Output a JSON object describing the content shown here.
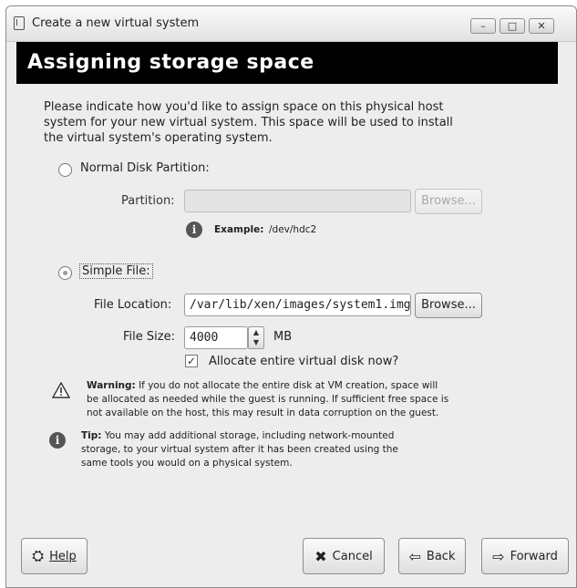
{
  "window": {
    "title": "Create a new virtual system",
    "controls": {
      "minimize": "–",
      "maximize": "□",
      "close": "✕"
    }
  },
  "banner": {
    "title": "Assigning storage space"
  },
  "intro": "Please indicate how you'd like to assign space on this physical host system for your new virtual system. This space will be used to install the virtual system's operating system.",
  "partition_option": {
    "label": "Normal Disk Partition:",
    "selected": false,
    "partition_label": "Partition:",
    "partition_value": "",
    "browse_label": "Browse...",
    "example_bold": "Example:",
    "example_value": "/dev/hdc2"
  },
  "file_option": {
    "label": "Simple File:",
    "selected": true,
    "location_label": "File Location:",
    "location_value": "/var/lib/xen/images/system1.img",
    "browse_label": "Browse...",
    "size_label": "File Size:",
    "size_value": "4000",
    "size_unit": "MB",
    "allocate_label": "Allocate entire virtual disk now?",
    "allocate_checked": true
  },
  "warning": {
    "bold": "Warning:",
    "line1": " If you do not allocate the entire disk at VM creation, space will",
    "line2": "be allocated as needed while the guest is running. If sufficient free space is",
    "line3": "not available on the host, this may result in data corruption on the guest."
  },
  "tip": {
    "bold": "Tip:",
    "line1": " You may add additional storage, including network-mounted",
    "line2": "storage, to your virtual system after it has been created using the",
    "line3": "same tools you would on a physical system."
  },
  "footer": {
    "help": "Help",
    "cancel": "Cancel",
    "back": "Back",
    "forward": "Forward"
  },
  "icons": {
    "info": "info-icon",
    "warning": "warning-icon",
    "help": "lifebuoy-icon",
    "cancel": "x-icon",
    "back": "left-arrow-icon",
    "forward": "right-arrow-icon"
  }
}
